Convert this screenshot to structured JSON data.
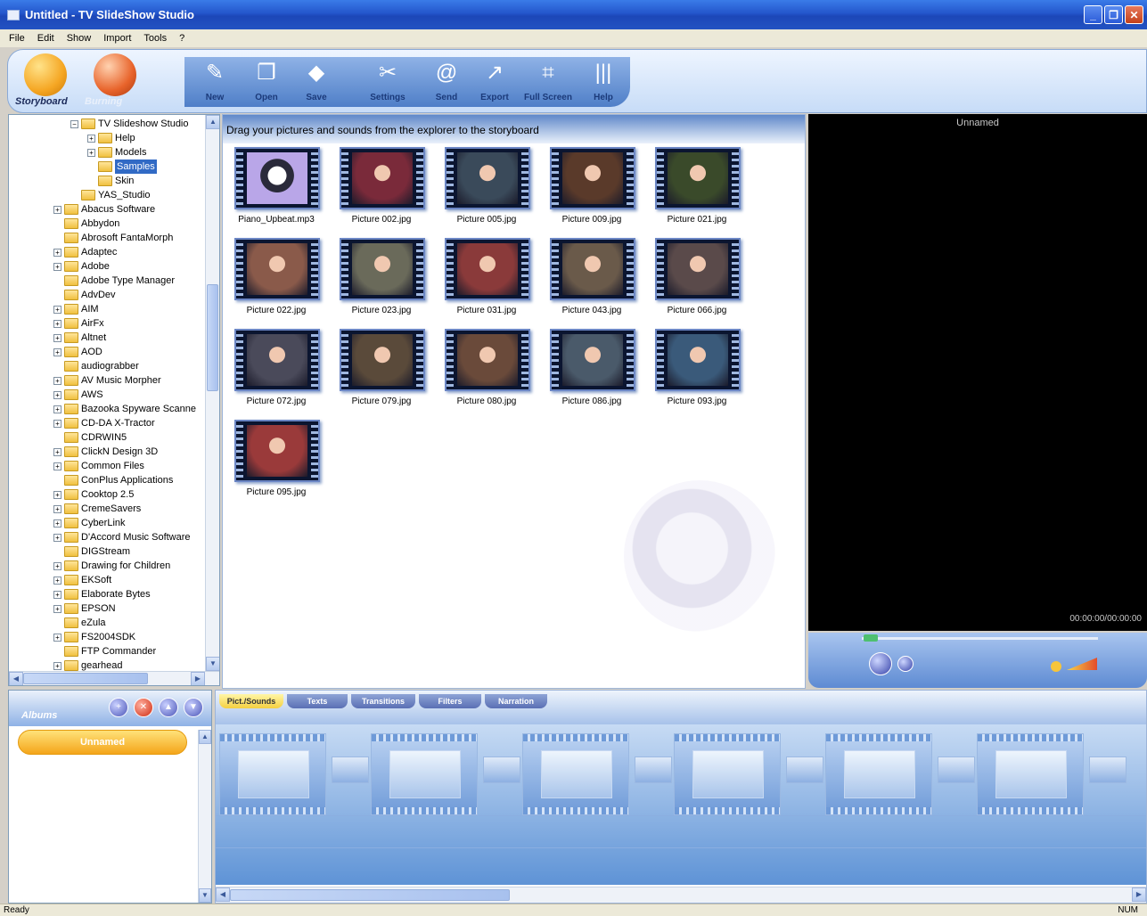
{
  "window": {
    "title": "Untitled - TV SlideShow Studio",
    "buttons": [
      "minimize-icon",
      "maximize-icon",
      "close-icon"
    ]
  },
  "menu": {
    "items": [
      "File",
      "Edit",
      "Show",
      "Import",
      "Tools",
      "?"
    ]
  },
  "toolbar": {
    "modes": [
      {
        "label": "Storyboard",
        "active": true,
        "color": "#f5a623"
      },
      {
        "label": "Burning",
        "active": false,
        "color": "#e8632a"
      }
    ],
    "buttons": [
      {
        "label": "New",
        "icon": "new-icon"
      },
      {
        "label": "Open",
        "icon": "open-icon"
      },
      {
        "label": "Save",
        "icon": "save-icon"
      },
      {
        "label": "Settings",
        "icon": "settings-icon"
      },
      {
        "label": "Send",
        "icon": "email-icon"
      },
      {
        "label": "Export",
        "icon": "export-icon"
      },
      {
        "label": "Full Screen",
        "icon": "fullscreen-icon"
      },
      {
        "label": "Help",
        "icon": "help-icon"
      }
    ]
  },
  "tree": {
    "items": [
      {
        "label": "TV Slideshow Studio",
        "expander": "minus",
        "selected": false
      },
      {
        "label": "Help",
        "expander": "plus",
        "selected": false
      },
      {
        "label": "Models",
        "expander": "plus",
        "selected": false
      },
      {
        "label": "Samples",
        "expander": "",
        "selected": true
      },
      {
        "label": "Skin",
        "expander": "",
        "selected": false
      },
      {
        "label": "YAS_Studio",
        "expander": "",
        "selected": false
      },
      {
        "label": "Abacus Software",
        "expander": "plus",
        "selected": false
      },
      {
        "label": "Abbydon",
        "expander": "",
        "selected": false
      },
      {
        "label": "Abrosoft FantaMorph",
        "expander": "",
        "selected": false
      },
      {
        "label": "Adaptec",
        "expander": "plus",
        "selected": false
      },
      {
        "label": "Adobe",
        "expander": "plus",
        "selected": false
      },
      {
        "label": "Adobe Type Manager",
        "expander": "",
        "selected": false
      },
      {
        "label": "AdvDev",
        "expander": "",
        "selected": false
      },
      {
        "label": "AIM",
        "expander": "plus",
        "selected": false
      },
      {
        "label": "AirFx",
        "expander": "plus",
        "selected": false
      },
      {
        "label": "Altnet",
        "expander": "plus",
        "selected": false
      },
      {
        "label": "AOD",
        "expander": "plus",
        "selected": false
      },
      {
        "label": "audiograbber",
        "expander": "",
        "selected": false
      },
      {
        "label": "AV Music Morpher",
        "expander": "plus",
        "selected": false
      },
      {
        "label": "AWS",
        "expander": "plus",
        "selected": false
      },
      {
        "label": "Bazooka Spyware Scanne",
        "expander": "plus",
        "selected": false
      },
      {
        "label": "CD-DA X-Tractor",
        "expander": "plus",
        "selected": false
      },
      {
        "label": "CDRWIN5",
        "expander": "",
        "selected": false
      },
      {
        "label": "ClickN Design 3D",
        "expander": "plus",
        "selected": false
      },
      {
        "label": "Common Files",
        "expander": "plus",
        "selected": false
      },
      {
        "label": "ConPlus Applications",
        "expander": "",
        "selected": false
      },
      {
        "label": "Cooktop 2.5",
        "expander": "plus",
        "selected": false
      },
      {
        "label": "CremeSavers",
        "expander": "plus",
        "selected": false
      },
      {
        "label": "CyberLink",
        "expander": "plus",
        "selected": false
      },
      {
        "label": "D'Accord Music Software",
        "expander": "plus",
        "selected": false
      },
      {
        "label": "DIGStream",
        "expander": "",
        "selected": false
      },
      {
        "label": "Drawing for Children",
        "expander": "plus",
        "selected": false
      },
      {
        "label": "EKSoft",
        "expander": "plus",
        "selected": false
      },
      {
        "label": "Elaborate Bytes",
        "expander": "plus",
        "selected": false
      },
      {
        "label": "EPSON",
        "expander": "plus",
        "selected": false
      },
      {
        "label": "eZula",
        "expander": "",
        "selected": false
      },
      {
        "label": "FS2004SDK",
        "expander": "plus",
        "selected": false
      },
      {
        "label": "FTP Commander",
        "expander": "",
        "selected": false
      },
      {
        "label": "gearhead",
        "expander": "plus",
        "selected": false
      }
    ]
  },
  "explorer": {
    "hint": "Drag your pictures and sounds from the explorer to the storyboard",
    "files": [
      {
        "name": "Piano_Upbeat.mp3",
        "kind": "audio",
        "color": "#6a4fa8"
      },
      {
        "name": "Picture 002.jpg",
        "kind": "image",
        "color": "#7a2a3a"
      },
      {
        "name": "Picture 005.jpg",
        "kind": "image",
        "color": "#3a4a5a"
      },
      {
        "name": "Picture 009.jpg",
        "kind": "image",
        "color": "#5a3a2a"
      },
      {
        "name": "Picture 021.jpg",
        "kind": "image",
        "color": "#3a4a2a"
      },
      {
        "name": "Picture 022.jpg",
        "kind": "image",
        "color": "#8a5a4a"
      },
      {
        "name": "Picture 023.jpg",
        "kind": "image",
        "color": "#6a6a5a"
      },
      {
        "name": "Picture 031.jpg",
        "kind": "image",
        "color": "#8a3a3a"
      },
      {
        "name": "Picture 043.jpg",
        "kind": "image",
        "color": "#6a5a4a"
      },
      {
        "name": "Picture 066.jpg",
        "kind": "image",
        "color": "#5a4a4a"
      },
      {
        "name": "Picture 072.jpg",
        "kind": "image",
        "color": "#4a4a5a"
      },
      {
        "name": "Picture 079.jpg",
        "kind": "image",
        "color": "#5a4a3a"
      },
      {
        "name": "Picture 080.jpg",
        "kind": "image",
        "color": "#6a4a3a"
      },
      {
        "name": "Picture 086.jpg",
        "kind": "image",
        "color": "#4a5a6a"
      },
      {
        "name": "Picture 093.jpg",
        "kind": "image",
        "color": "#3a5a7a"
      },
      {
        "name": "Picture 095.jpg",
        "kind": "image",
        "color": "#9a3a3a"
      }
    ]
  },
  "preview": {
    "title": "Unnamed",
    "time": "00:00:00/00:00:00"
  },
  "albums": {
    "title": "Albums",
    "controls": [
      "add-icon",
      "delete-icon",
      "up-icon",
      "down-icon"
    ],
    "items": [
      "Unnamed"
    ]
  },
  "storyboard": {
    "tabs": [
      "Pict./Sounds",
      "Texts",
      "Transitions",
      "Filters",
      "Narration"
    ],
    "active_tab": 0
  },
  "status": {
    "left": "Ready",
    "right": "NUM"
  }
}
